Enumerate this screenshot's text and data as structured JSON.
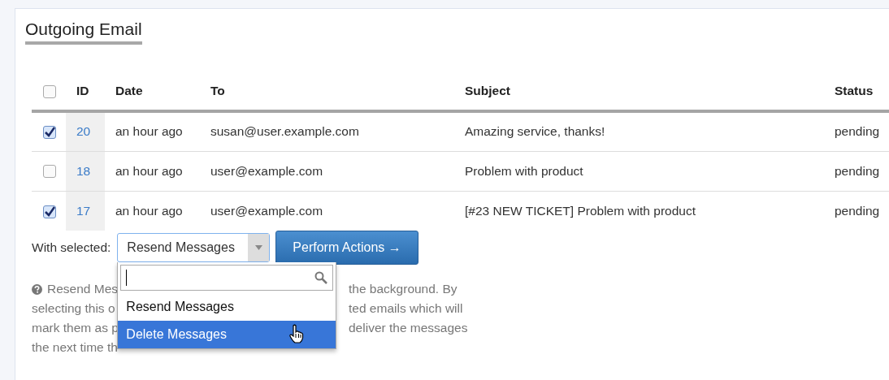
{
  "title": "Outgoing Email",
  "table": {
    "select_all_checked": false,
    "columns": [
      "ID",
      "Date",
      "To",
      "Subject",
      "Status"
    ],
    "rows": [
      {
        "checked": true,
        "id": "20",
        "date": "an hour ago",
        "to": "susan@user.example.com",
        "subject": "Amazing service, thanks!",
        "status": "pending"
      },
      {
        "checked": false,
        "id": "18",
        "date": "an hour ago",
        "to": "user@example.com",
        "subject": "Problem with product",
        "status": "pending"
      },
      {
        "checked": true,
        "id": "17",
        "date": "an hour ago",
        "to": "user@example.com",
        "subject": "[#23 NEW TICKET] Problem with product",
        "status": "pending"
      }
    ]
  },
  "actions": {
    "label": "With selected:",
    "select_value": "Resend Messages",
    "button": "Perform Actions →",
    "dropdown": {
      "options": [
        {
          "label": "Resend Messages",
          "selected": false
        },
        {
          "label": "Delete Messages",
          "selected": true
        }
      ]
    }
  },
  "help": {
    "lines": [
      {
        "left": "Resend Mes",
        "right": "the background. By"
      },
      {
        "left": "selecting this o",
        "right": "ted emails which will"
      },
      {
        "left": "mark them as p",
        "right": "deliver the messages"
      },
      {
        "left": "the next time th"
      }
    ]
  }
}
